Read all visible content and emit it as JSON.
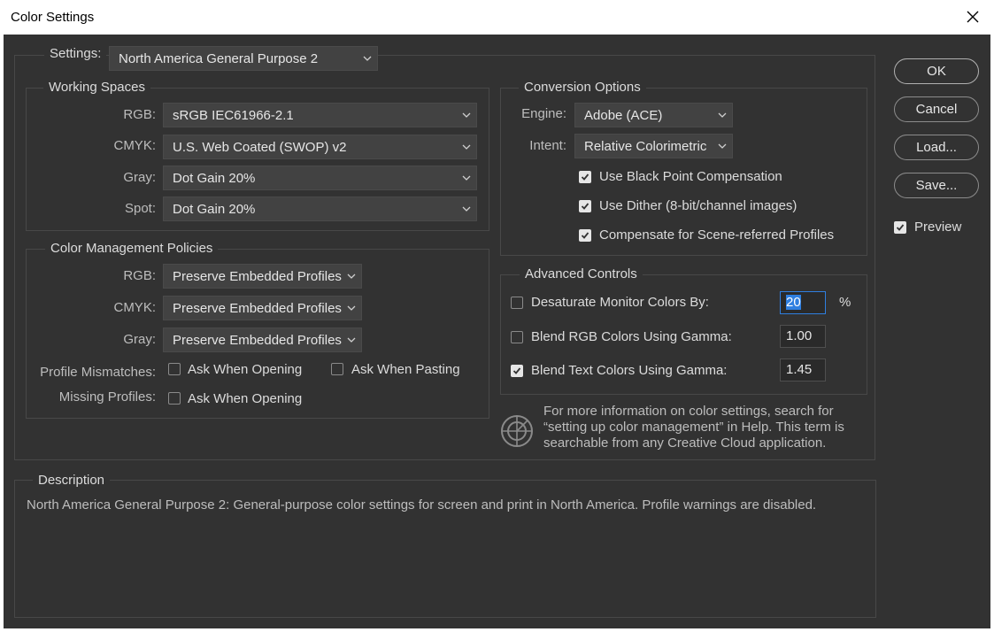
{
  "window": {
    "title": "Color Settings"
  },
  "settings": {
    "label": "Settings:",
    "value": "North America General Purpose 2"
  },
  "working_spaces": {
    "title": "Working Spaces",
    "rows": [
      {
        "label": "RGB:",
        "value": "sRGB IEC61966-2.1"
      },
      {
        "label": "CMYK:",
        "value": "U.S. Web Coated (SWOP) v2"
      },
      {
        "label": "Gray:",
        "value": "Dot Gain 20%"
      },
      {
        "label": "Spot:",
        "value": "Dot Gain 20%"
      }
    ]
  },
  "policies": {
    "title": "Color Management Policies",
    "rows": [
      {
        "label": "RGB:",
        "value": "Preserve Embedded Profiles"
      },
      {
        "label": "CMYK:",
        "value": "Preserve Embedded Profiles"
      },
      {
        "label": "Gray:",
        "value": "Preserve Embedded Profiles"
      }
    ],
    "mismatch_label": "Profile Mismatches:",
    "mismatch_opening": {
      "label": "Ask When Opening",
      "checked": false
    },
    "mismatch_pasting": {
      "label": "Ask When Pasting",
      "checked": false
    },
    "missing_label": "Missing Profiles:",
    "missing_opening": {
      "label": "Ask When Opening",
      "checked": false
    }
  },
  "conversion": {
    "title": "Conversion Options",
    "engine_label": "Engine:",
    "engine_value": "Adobe (ACE)",
    "intent_label": "Intent:",
    "intent_value": "Relative Colorimetric",
    "black_point": {
      "label": "Use Black Point Compensation",
      "checked": true
    },
    "dither": {
      "label": "Use Dither (8-bit/channel images)",
      "checked": true
    },
    "scene": {
      "label": "Compensate for Scene-referred Profiles",
      "checked": true
    }
  },
  "advanced": {
    "title": "Advanced Controls",
    "desaturate": {
      "label": "Desaturate Monitor Colors By:",
      "checked": false,
      "value": "20",
      "unit": "%"
    },
    "blend_rgb": {
      "label": "Blend RGB Colors Using Gamma:",
      "checked": false,
      "value": "1.00"
    },
    "blend_text": {
      "label": "Blend Text Colors Using Gamma:",
      "checked": true,
      "value": "1.45"
    }
  },
  "info": {
    "icon": "color-wheel-icon",
    "line1": "For more information on color settings, search for",
    "line2": "“setting up color management” in Help. This term is",
    "line3": "searchable from any Creative Cloud application."
  },
  "buttons": {
    "ok": "OK",
    "cancel": "Cancel",
    "load": "Load...",
    "save": "Save..."
  },
  "preview": {
    "label": "Preview",
    "checked": true
  },
  "description": {
    "title": "Description",
    "text": "North America General Purpose 2:  General-purpose color settings for screen and print in North America. Profile warnings are disabled."
  },
  "colors": {
    "panel": "#323232",
    "focus": "#2f7fe0"
  }
}
